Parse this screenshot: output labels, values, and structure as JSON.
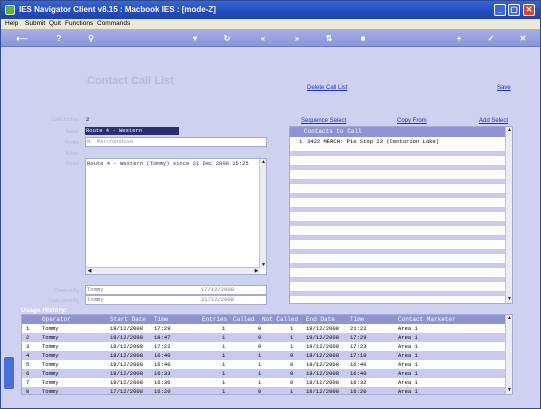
{
  "window": {
    "title": "IES Navigator Client v8.15 : Macbook IES :      [mode-Z]"
  },
  "menu": [
    "Help",
    "Submit",
    "Quit",
    "Functions",
    "Commands"
  ],
  "page": {
    "title": "Contact Call List",
    "delete_link": "Delete Call List",
    "save_link": "Save"
  },
  "form": {
    "labels": {
      "call_list_key": "Call List Key",
      "name": "Name",
      "profile": "Profile",
      "active": "Active",
      "notes": "Notes",
      "created_by": "Created By",
      "last_used_by": "Last Used By"
    },
    "call_list_key": "2",
    "name": "Route 4 - Western",
    "profile": "M: Merchandise",
    "notes": "Route 4 - Western (Tommy) since 21 Dec 2008 15:25",
    "created_by": "Tommy",
    "created_date": "17/12/2008",
    "last_used_by": "Tommy",
    "last_used_date": "21/12/2008"
  },
  "contacts": {
    "sequence_select": "Sequence Select",
    "copy_from": "Copy From",
    "add_select": "Add Select",
    "header": "Contacts to Call",
    "rows": [
      {
        "num": "1",
        "text": "3422 MERCH: Pie Stop 23 (Centurion Lake)"
      }
    ]
  },
  "usage": {
    "title": "Usage History:",
    "columns": [
      "Operator",
      "Start Date",
      "Time",
      "Entries",
      "Called",
      "Not Called",
      "End Date",
      "Time",
      "Contact Marketer"
    ],
    "rows": [
      {
        "n": "1",
        "op": "Tommy",
        "sd": "19/12/2008",
        "st": "17:29",
        "en": "1",
        "ca": "0",
        "nc": "1",
        "ed": "19/12/2008",
        "et": "21:22",
        "cm": "Area 1"
      },
      {
        "n": "2",
        "op": "Tommy",
        "sd": "18/12/2008",
        "st": "18:47",
        "en": "1",
        "ca": "0",
        "nc": "1",
        "ed": "19/12/2008",
        "et": "17:29",
        "cm": "Area 1"
      },
      {
        "n": "3",
        "op": "Tommy",
        "sd": "18/12/2008",
        "st": "17:22",
        "en": "1",
        "ca": "0",
        "nc": "1",
        "ed": "18/12/2008",
        "et": "17:23",
        "cm": "Area 1"
      },
      {
        "n": "4",
        "op": "Tommy",
        "sd": "18/12/2008",
        "st": "16:40",
        "en": "1",
        "ca": "1",
        "nc": "0",
        "ed": "18/12/2008",
        "et": "17:19",
        "cm": "Area 1"
      },
      {
        "n": "5",
        "op": "Tommy",
        "sd": "18/12/2008",
        "st": "16:40",
        "en": "1",
        "ca": "1",
        "nc": "0",
        "ed": "18/12/2008",
        "et": "16:40",
        "cm": "Area 1"
      },
      {
        "n": "6",
        "op": "Tommy",
        "sd": "18/12/2008",
        "st": "16:33",
        "en": "1",
        "ca": "1",
        "nc": "0",
        "ed": "18/12/2008",
        "et": "16:40",
        "cm": "Area 1"
      },
      {
        "n": "7",
        "op": "Tommy",
        "sd": "18/12/2008",
        "st": "16:30",
        "en": "1",
        "ca": "1",
        "nc": "0",
        "ed": "18/12/2008",
        "et": "16:32",
        "cm": "Area 1"
      },
      {
        "n": "8",
        "op": "Tommy",
        "sd": "17/12/2008",
        "st": "16:20",
        "en": "1",
        "ca": "0",
        "nc": "1",
        "ed": "18/12/2008",
        "et": "16:20",
        "cm": "Area 1"
      }
    ]
  }
}
